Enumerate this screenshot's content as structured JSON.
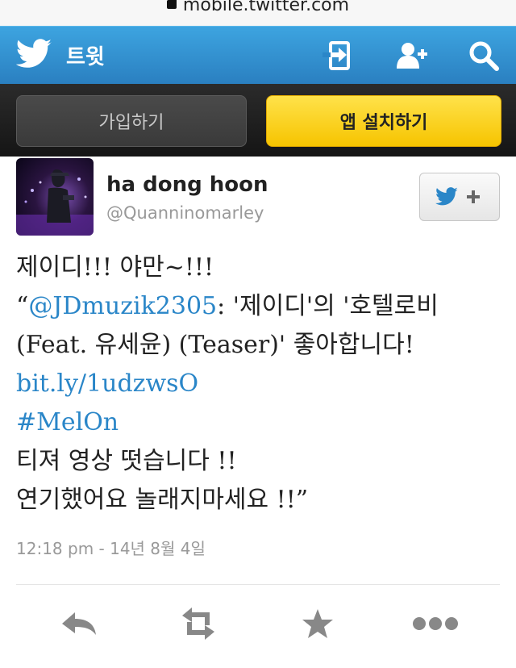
{
  "browser": {
    "url": "mobile.twitter.com"
  },
  "topbar": {
    "title": "트윗",
    "icons": [
      "signin-icon",
      "add-user-icon",
      "search-icon"
    ]
  },
  "signup": {
    "join_label": "가입하기",
    "install_app_label": "앱 설치하기"
  },
  "tweet": {
    "author_name": "ha dong hoon",
    "author_handle": "@Quanninomarley",
    "lines": [
      {
        "parts": [
          {
            "text": "제이디!!! 야만~!!!"
          }
        ]
      },
      {
        "parts": [
          {
            "text": "“"
          },
          {
            "text": "@JDmuzik2305",
            "link": true
          },
          {
            "text": ": '제이디'의 '호텔로비"
          }
        ]
      },
      {
        "parts": [
          {
            "text": "(Feat. 유세윤) (Teaser)' 좋아합니다!"
          }
        ]
      },
      {
        "parts": [
          {
            "text": "bit.ly/1udzwsO",
            "link": true
          }
        ]
      },
      {
        "parts": [
          {
            "text": "#MelOn",
            "link": true
          }
        ]
      },
      {
        "parts": [
          {
            "text": "티져 영상 떳습니다 !!"
          }
        ]
      },
      {
        "parts": [
          {
            "text": "연기했어요 놀래지마세요 !!”"
          }
        ]
      }
    ],
    "timestamp": "12:18 pm - 14년 8월 4일"
  },
  "actions": [
    "reply-icon",
    "retweet-icon",
    "favorite-icon",
    "more-icon"
  ],
  "colors": {
    "topbar": "#2a8fd1",
    "accent_link": "#2a86c8",
    "app_button": "#f8cc10"
  }
}
